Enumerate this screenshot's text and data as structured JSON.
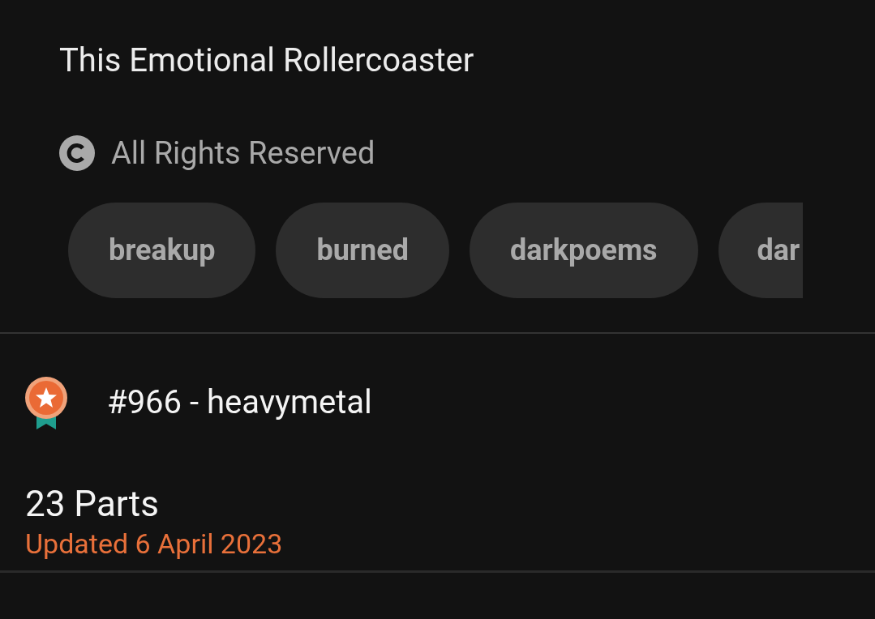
{
  "story": {
    "title": "This Emotional Rollercoaster",
    "license": "All Rights Reserved"
  },
  "tags": [
    {
      "label": "breakup",
      "cut": false
    },
    {
      "label": "burned",
      "cut": false
    },
    {
      "label": "darkpoems",
      "cut": false
    },
    {
      "label": "dar",
      "cut": true
    }
  ],
  "ranking": {
    "text": "#966 - heavymetal"
  },
  "parts": {
    "count": "23 Parts",
    "updated": "Updated 6 April 2023"
  }
}
